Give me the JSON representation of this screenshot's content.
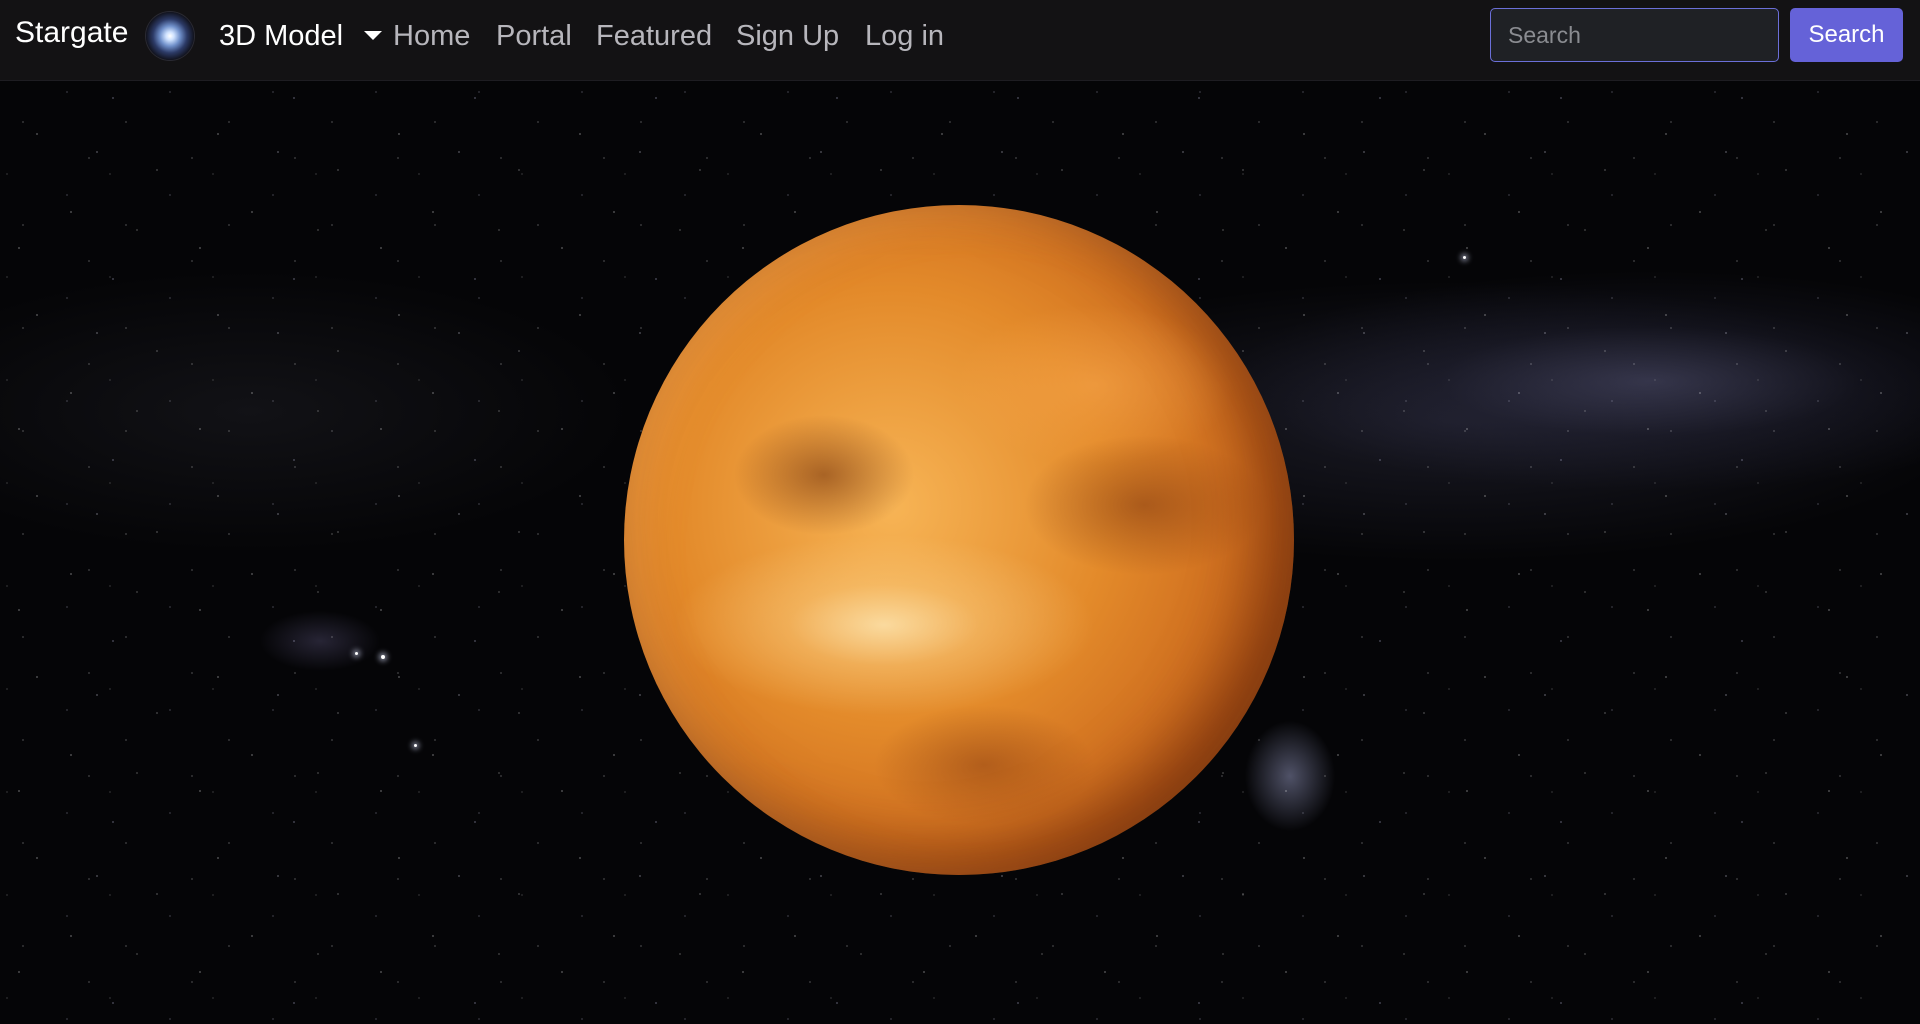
{
  "navbar": {
    "brand": "Stargate",
    "dropdown_label": "3D Model",
    "links": [
      "Home",
      "Portal",
      "Featured",
      "Sign Up",
      "Log in"
    ],
    "search": {
      "placeholder": "Search",
      "value": "",
      "button_label": "Search"
    }
  },
  "colors": {
    "navbar_bg": "#131214",
    "accent": "#6562d8",
    "nav_text": "#b7b6bc"
  },
  "icons": {
    "brand_logo": "galaxy-logo-icon",
    "dropdown": "caret-down-icon"
  },
  "scene": {
    "subject": "planet-3d-model"
  }
}
